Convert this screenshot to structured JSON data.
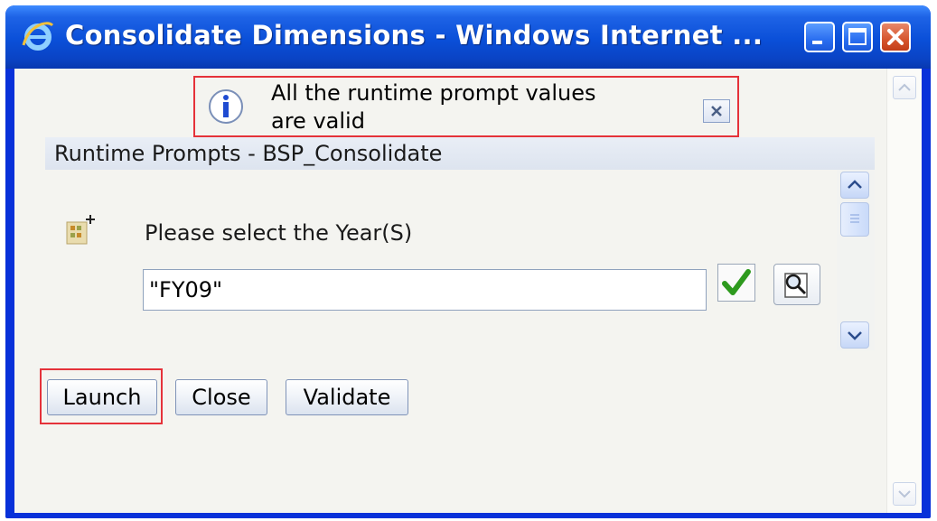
{
  "window": {
    "title": "Consolidate Dimensions - Windows Internet ...",
    "controls": {
      "minimize": "minimize-icon",
      "maximize": "maximize-icon",
      "close": "close-icon"
    }
  },
  "message": {
    "icon": "info-icon",
    "line1": "All the runtime prompt values",
    "line2": "are valid",
    "close_icon": "close-x-icon"
  },
  "section": {
    "title": "Runtime Prompts - BSP_Consolidate"
  },
  "prompt": {
    "icon": "member-select-icon",
    "label": "Please select the Year(S)",
    "value": "\"FY09\"",
    "validate_icon": "checkmark-icon",
    "lookup_icon": "member-lookup-icon"
  },
  "buttons": {
    "launch": "Launch",
    "close": "Close",
    "validate": "Validate"
  },
  "colors": {
    "titlebar": "#0a4fd8",
    "highlight": "#e5323a",
    "client_bg": "#f4f4f0",
    "section_bg": "#e3e9f2",
    "check_green": "#2e9a1e"
  }
}
